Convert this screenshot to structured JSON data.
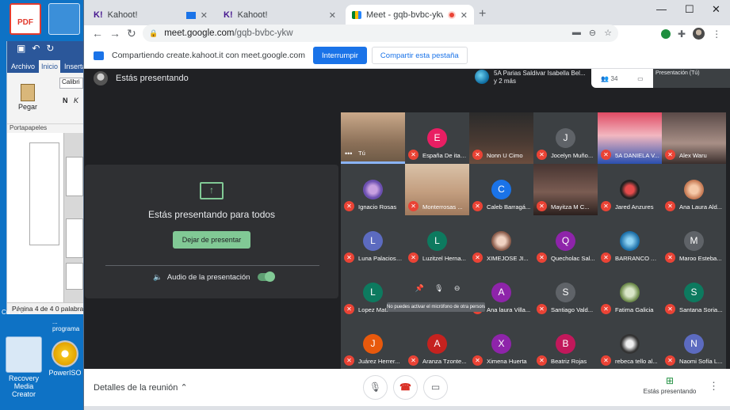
{
  "desktop": {
    "pdf_icon_text": "PDF",
    "recovery_label": "Recovery Media Creator",
    "poweriso_label": "PowerISO",
    "below_word_left": "Cu ... lo ...",
    "below_word_right": "... programa"
  },
  "word": {
    "tabs": [
      "Archivo",
      "Inicio",
      "Insertar"
    ],
    "active_tab_index": 1,
    "paste_label": "Pegar",
    "font_value": "Calibri",
    "clipboard_label": "Portapapeles",
    "status_page": "Página 4 de 4",
    "status_words": "0 palabras"
  },
  "browser": {
    "tabs": [
      {
        "label": "Kahoot!",
        "favicon": "kahoot-icon",
        "indicator": "cast"
      },
      {
        "label": "Kahoot!",
        "favicon": "kahoot-icon"
      },
      {
        "label": "Meet - gqb-bvbc-ykw",
        "favicon": "meet-icon",
        "indicator": "recording",
        "active": true
      }
    ],
    "url_host": "meet.google.com",
    "url_path": "/gqb-bvbc-ykw"
  },
  "share_bar": {
    "text": "Compartiendo create.kahoot.it con meet.google.com",
    "stop_label": "Interrumpir",
    "share_tab_label": "Compartir esta pestaña"
  },
  "meet": {
    "presenting_header": "Estás presentando",
    "pinned_line1": "5A Parias Saldivar Isabella Bel...",
    "pinned_line2": "y 2 más",
    "participant_count": "34",
    "self_thumb_label": "Presentación (Tú)",
    "present_message": "Estás presentando para todos",
    "stop_present_label": "Dejar de presentar",
    "audio_label": "Audio de la presentación",
    "audio_enabled": true,
    "hover_tooltip": "No puedes activar el micrófono de otra persona",
    "participants": [
      {
        "name": "Tú",
        "type": "video",
        "self": true
      },
      {
        "name": "España De ita ...",
        "initial": "E",
        "color": "#e91e63"
      },
      {
        "name": "Nonn U Cimo",
        "type": "video"
      },
      {
        "name": "Jocelyn Muño...",
        "initial": "J",
        "color": "#5f6368"
      },
      {
        "name": "5A DANIELA V...",
        "type": "video"
      },
      {
        "name": "Alex Waru",
        "type": "video"
      },
      {
        "name": "Ignacio Rosas",
        "type": "avatar"
      },
      {
        "name": "Monterrosas ...",
        "type": "video"
      },
      {
        "name": "Caleb Barragá...",
        "initial": "C",
        "color": "#1a73e8"
      },
      {
        "name": "Mayitza M C...",
        "type": "video"
      },
      {
        "name": "Jared Anzures",
        "type": "avatar"
      },
      {
        "name": "Ana Laura Ald...",
        "type": "avatar"
      },
      {
        "name": "Luna Palacios ...",
        "initial": "L",
        "color": "#5c6bc0"
      },
      {
        "name": "Luzitzel Herna...",
        "initial": "L",
        "color": "#0d7a5f"
      },
      {
        "name": "XIMEJOSE JI...",
        "type": "avatar"
      },
      {
        "name": "Quecholac Sal...",
        "initial": "Q",
        "color": "#8e24aa"
      },
      {
        "name": "BARRANCO A...",
        "type": "avatar"
      },
      {
        "name": "Maroo Esteba...",
        "initial": "M",
        "color": "#5f6368"
      },
      {
        "name": "Lopez Mata ...",
        "initial": "L",
        "color": "#0d7a5f"
      },
      {
        "name": "",
        "type": "hover"
      },
      {
        "name": "Ana laura Villa...",
        "initial": "A",
        "color": "#8e24aa"
      },
      {
        "name": "Santiago Vald...",
        "initial": "S",
        "color": "#5f6368"
      },
      {
        "name": "Fatima Galicia",
        "type": "avatar"
      },
      {
        "name": "Santana Soria...",
        "initial": "S",
        "color": "#0d7a5f"
      },
      {
        "name": "Juárez Herrer...",
        "initial": "J",
        "color": "#e8590c"
      },
      {
        "name": "Aranza Tzonte...",
        "initial": "A",
        "color": "#c5221f"
      },
      {
        "name": "Ximena Huerta",
        "initial": "X",
        "color": "#8e24aa"
      },
      {
        "name": "Beatriz Rojas",
        "initial": "B",
        "color": "#c2185b"
      },
      {
        "name": "rebeca tello al...",
        "type": "avatar"
      },
      {
        "name": "Naomi Sofía L...",
        "initial": "N",
        "color": "#5c6bc0"
      }
    ]
  },
  "bottom_bar": {
    "details_label": "Detalles de la reunión",
    "presenting_label": "Estás presentando"
  }
}
